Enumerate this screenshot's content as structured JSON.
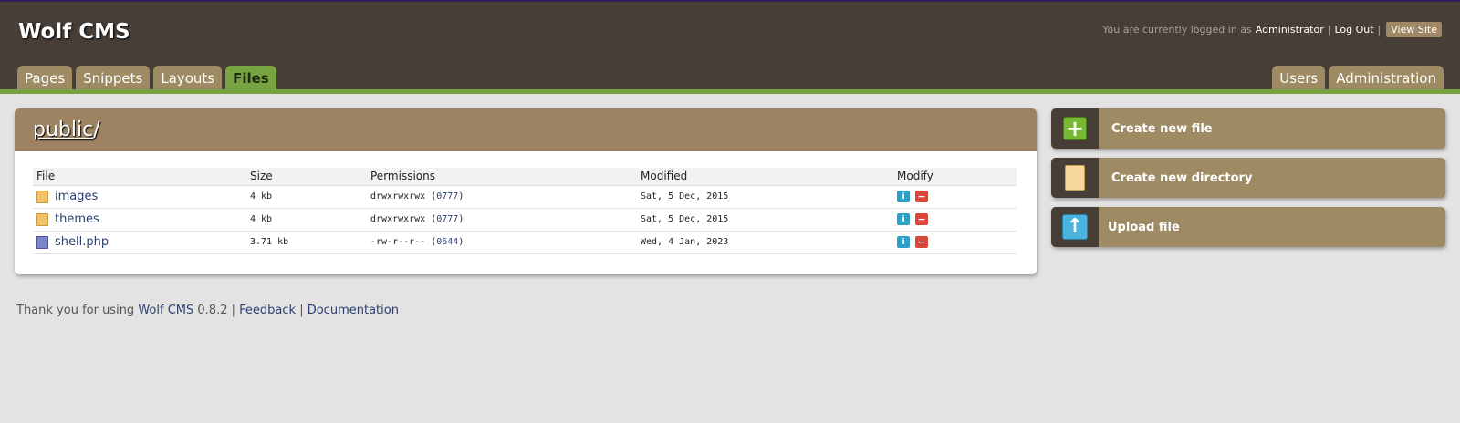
{
  "header": {
    "site_title": "Wolf CMS",
    "logged_in_text": "You are currently logged in as",
    "username": "Administrator",
    "separator": "|",
    "logout": "Log Out",
    "view_site": "View Site",
    "tabs_left": [
      "Pages",
      "Snippets",
      "Layouts",
      "Files"
    ],
    "active_tab": "Files",
    "tabs_right": [
      "Users",
      "Administration"
    ]
  },
  "main": {
    "path_dir": "public",
    "path_sep": "/",
    "columns": [
      "File",
      "Size",
      "Permissions",
      "Modified",
      "Modify"
    ],
    "rows": [
      {
        "name": "images",
        "type": "folder",
        "size": "4 kb",
        "perms": "drwxrwxrwx (",
        "perm_octal": "0777",
        "perm_close": ")",
        "modified": "Sat, 5 Dec, 2015"
      },
      {
        "name": "themes",
        "type": "folder",
        "size": "4 kb",
        "perms": "drwxrwxrwx (",
        "perm_octal": "0777",
        "perm_close": ")",
        "modified": "Sat, 5 Dec, 2015"
      },
      {
        "name": "shell.php",
        "type": "php",
        "size": "3.71 kb",
        "perms": "-rw-r--r-- (",
        "perm_octal": "0644",
        "perm_close": ")",
        "modified": "Wed, 4 Jan, 2023"
      }
    ]
  },
  "sidebar": {
    "new_file": "Create new file",
    "new_dir": "Create new directory",
    "upload": "Upload file",
    "info_glyph": "i",
    "remove_glyph": "−",
    "plus_glyph": "+",
    "arrow_glyph": "↑"
  },
  "footer": {
    "prefix": "Thank you for using",
    "cms_link": "Wolf CMS",
    "version": "0.8.2 |",
    "feedback": "Feedback",
    "sep": "|",
    "docs": "Documentation"
  },
  "colors": {
    "header_bg": "#483e38",
    "tab_bg": "#9e8a63",
    "active_tab": "#78a341",
    "panel_header": "#9e8362"
  }
}
